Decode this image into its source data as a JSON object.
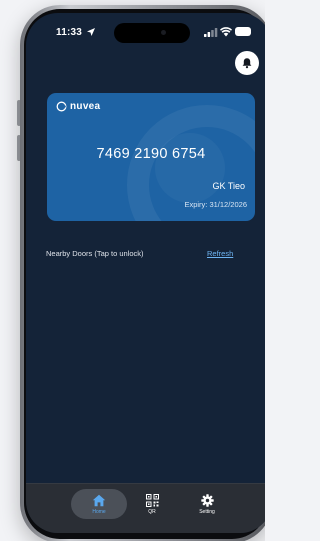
{
  "status_bar": {
    "time": "11:33"
  },
  "card": {
    "brand": "nuvea",
    "number": "7469 2190 6754",
    "holder": "GK Tieo",
    "expiry": "Expiry: 31/12/2026"
  },
  "doors": {
    "label": "Nearby Doors (Tap to unlock)",
    "refresh": "Refresh"
  },
  "nav": {
    "home": "Home",
    "qr": "QR",
    "setting": "Setting"
  },
  "colors": {
    "screen_bg": "#142338",
    "card_bg": "#1e63a4",
    "accent": "#5aa8ee",
    "nav_bg": "#2a2e35"
  },
  "icons": {
    "status": [
      "location-arrow-icon",
      "signal-icon",
      "wifi-icon",
      "battery-icon"
    ],
    "header": "bell-icon",
    "nav": [
      "home-icon",
      "qr-code-icon",
      "gear-icon"
    ]
  }
}
